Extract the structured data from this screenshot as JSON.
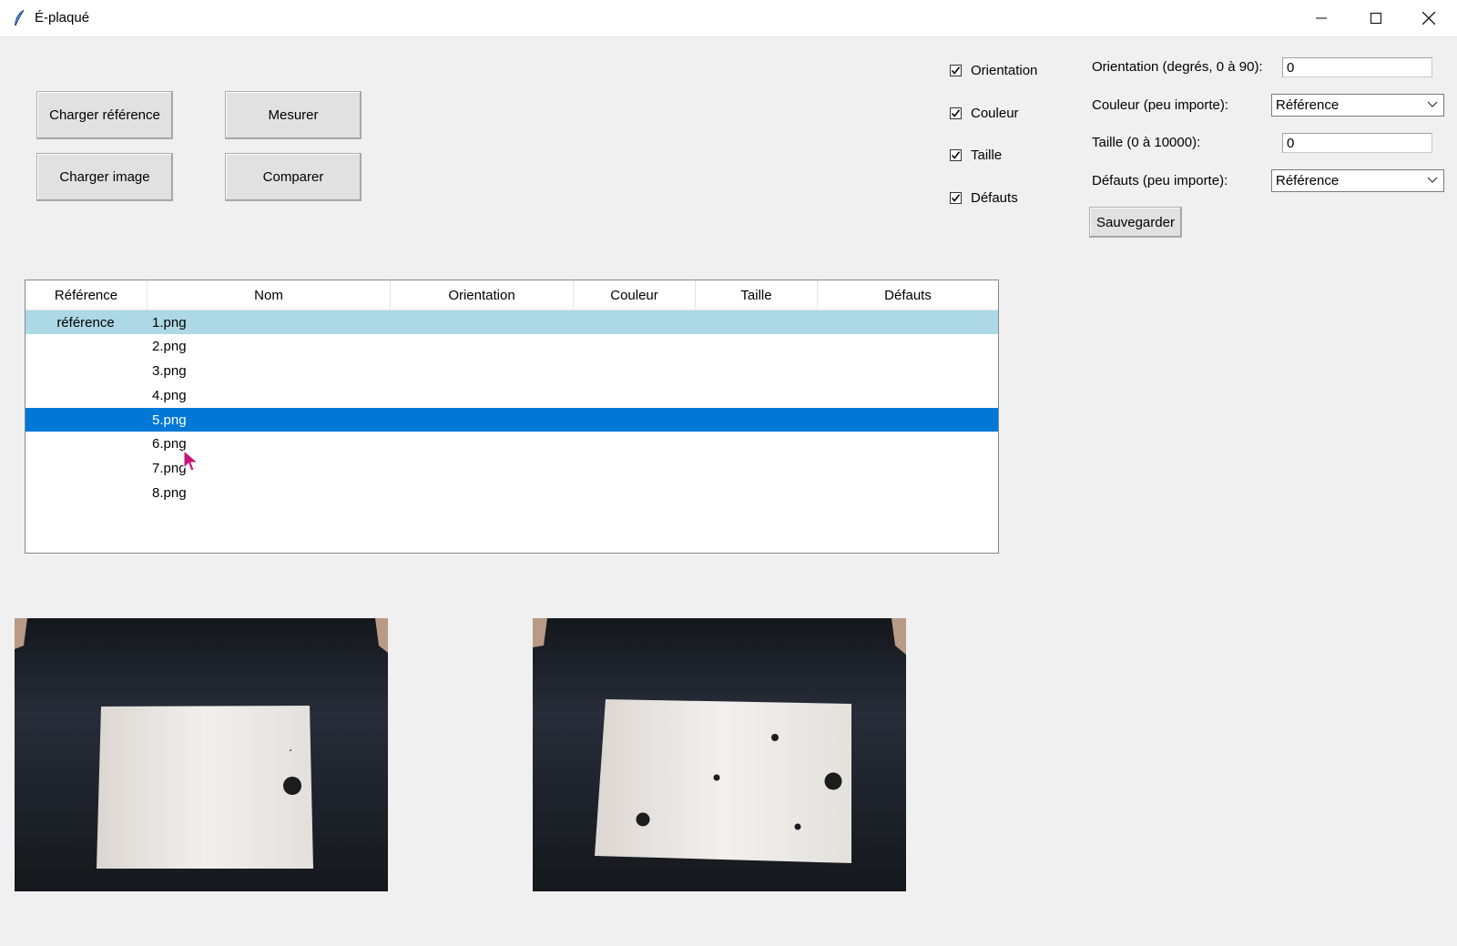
{
  "window": {
    "title": "É-plaqué"
  },
  "buttons": {
    "load_reference": "Charger référence",
    "measure": "Mesurer",
    "load_image": "Charger image",
    "compare": "Comparer",
    "save": "Sauvegarder"
  },
  "checkboxes": [
    {
      "label": "Orientation",
      "checked": true
    },
    {
      "label": "Couleur",
      "checked": true
    },
    {
      "label": "Taille",
      "checked": true
    },
    {
      "label": "Défauts",
      "checked": true
    }
  ],
  "settings": {
    "orientation_label": "Orientation (degrés, 0 à 90):",
    "orientation_value": "0",
    "color_label": "Couleur (peu importe):",
    "color_value": "Référence",
    "size_label": "Taille (0 à 10000):",
    "size_value": "0",
    "defects_label": "Défauts (peu importe):",
    "defects_value": "Référence"
  },
  "table": {
    "columns": [
      "Référence",
      "Nom",
      "Orientation",
      "Couleur",
      "Taille",
      "Défauts"
    ],
    "rows": [
      {
        "reference": "référence",
        "name": "1.png",
        "state": "reference"
      },
      {
        "reference": "",
        "name": "2.png",
        "state": ""
      },
      {
        "reference": "",
        "name": "3.png",
        "state": ""
      },
      {
        "reference": "",
        "name": "4.png",
        "state": ""
      },
      {
        "reference": "",
        "name": "5.png",
        "state": "selected"
      },
      {
        "reference": "",
        "name": "6.png",
        "state": ""
      },
      {
        "reference": "",
        "name": "7.png",
        "state": ""
      },
      {
        "reference": "",
        "name": "8.png",
        "state": ""
      }
    ]
  },
  "images": {
    "reference_image": "reference-photo",
    "compared_image": "compared-photo"
  },
  "colors": {
    "reference_row": "#add8e6",
    "selected_row": "#0078d7",
    "cursor": "#c8127a"
  }
}
